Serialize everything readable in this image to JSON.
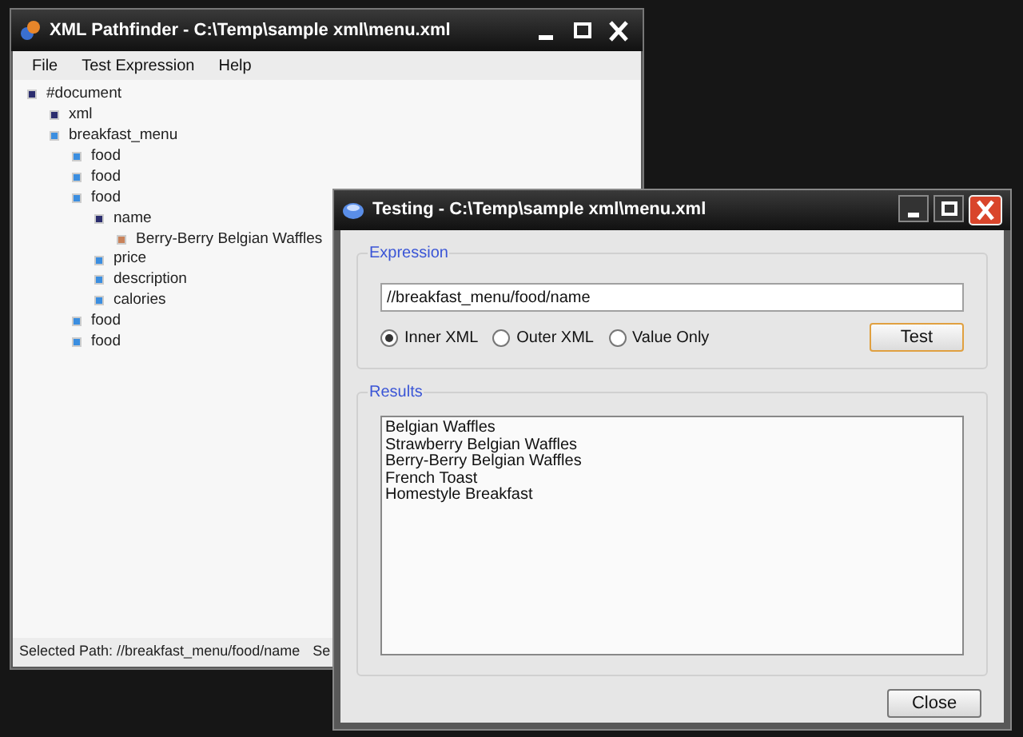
{
  "main_window": {
    "title": "XML Pathfinder - C:\\Temp\\sample xml\\menu.xml",
    "menu": [
      "File",
      "Test Expression",
      "Help"
    ],
    "tree": [
      {
        "label": "#document",
        "color": "#2b2d6e",
        "children": [
          {
            "label": "xml",
            "color": "#2b2d6e"
          },
          {
            "label": "breakfast_menu",
            "color": "#3b8ee0",
            "children": [
              {
                "label": "food",
                "color": "#3b8ee0"
              },
              {
                "label": "food",
                "color": "#3b8ee0"
              },
              {
                "label": "food",
                "color": "#3b8ee0",
                "children": [
                  {
                    "label": "name",
                    "color": "#2b2d6e",
                    "children": [
                      {
                        "label": "Berry-Berry Belgian Waffles",
                        "color": "#c9825a"
                      }
                    ]
                  },
                  {
                    "label": "price",
                    "color": "#3b8ee0"
                  },
                  {
                    "label": "description",
                    "color": "#3b8ee0"
                  },
                  {
                    "label": "calories",
                    "color": "#3b8ee0"
                  }
                ]
              },
              {
                "label": "food",
                "color": "#3b8ee0"
              },
              {
                "label": "food",
                "color": "#3b8ee0"
              }
            ]
          }
        ]
      }
    ],
    "status_bar": [
      "Selected Path: //breakfast_menu/food/name",
      "Se"
    ]
  },
  "dialog": {
    "title": "Testing - C:\\Temp\\sample xml\\menu.xml",
    "expression_group": "Expression",
    "expression": "//breakfast_menu/food/name",
    "options": [
      {
        "label": "Inner XML",
        "selected": true
      },
      {
        "label": "Outer XML",
        "selected": false
      },
      {
        "label": "Value Only",
        "selected": false
      }
    ],
    "test_button": "Test",
    "results_group": "Results",
    "results": [
      "Belgian Waffles",
      "Strawberry Belgian Waffles",
      "Berry-Berry Belgian Waffles",
      "French Toast",
      "Homestyle Breakfast"
    ],
    "close_button": "Close"
  }
}
